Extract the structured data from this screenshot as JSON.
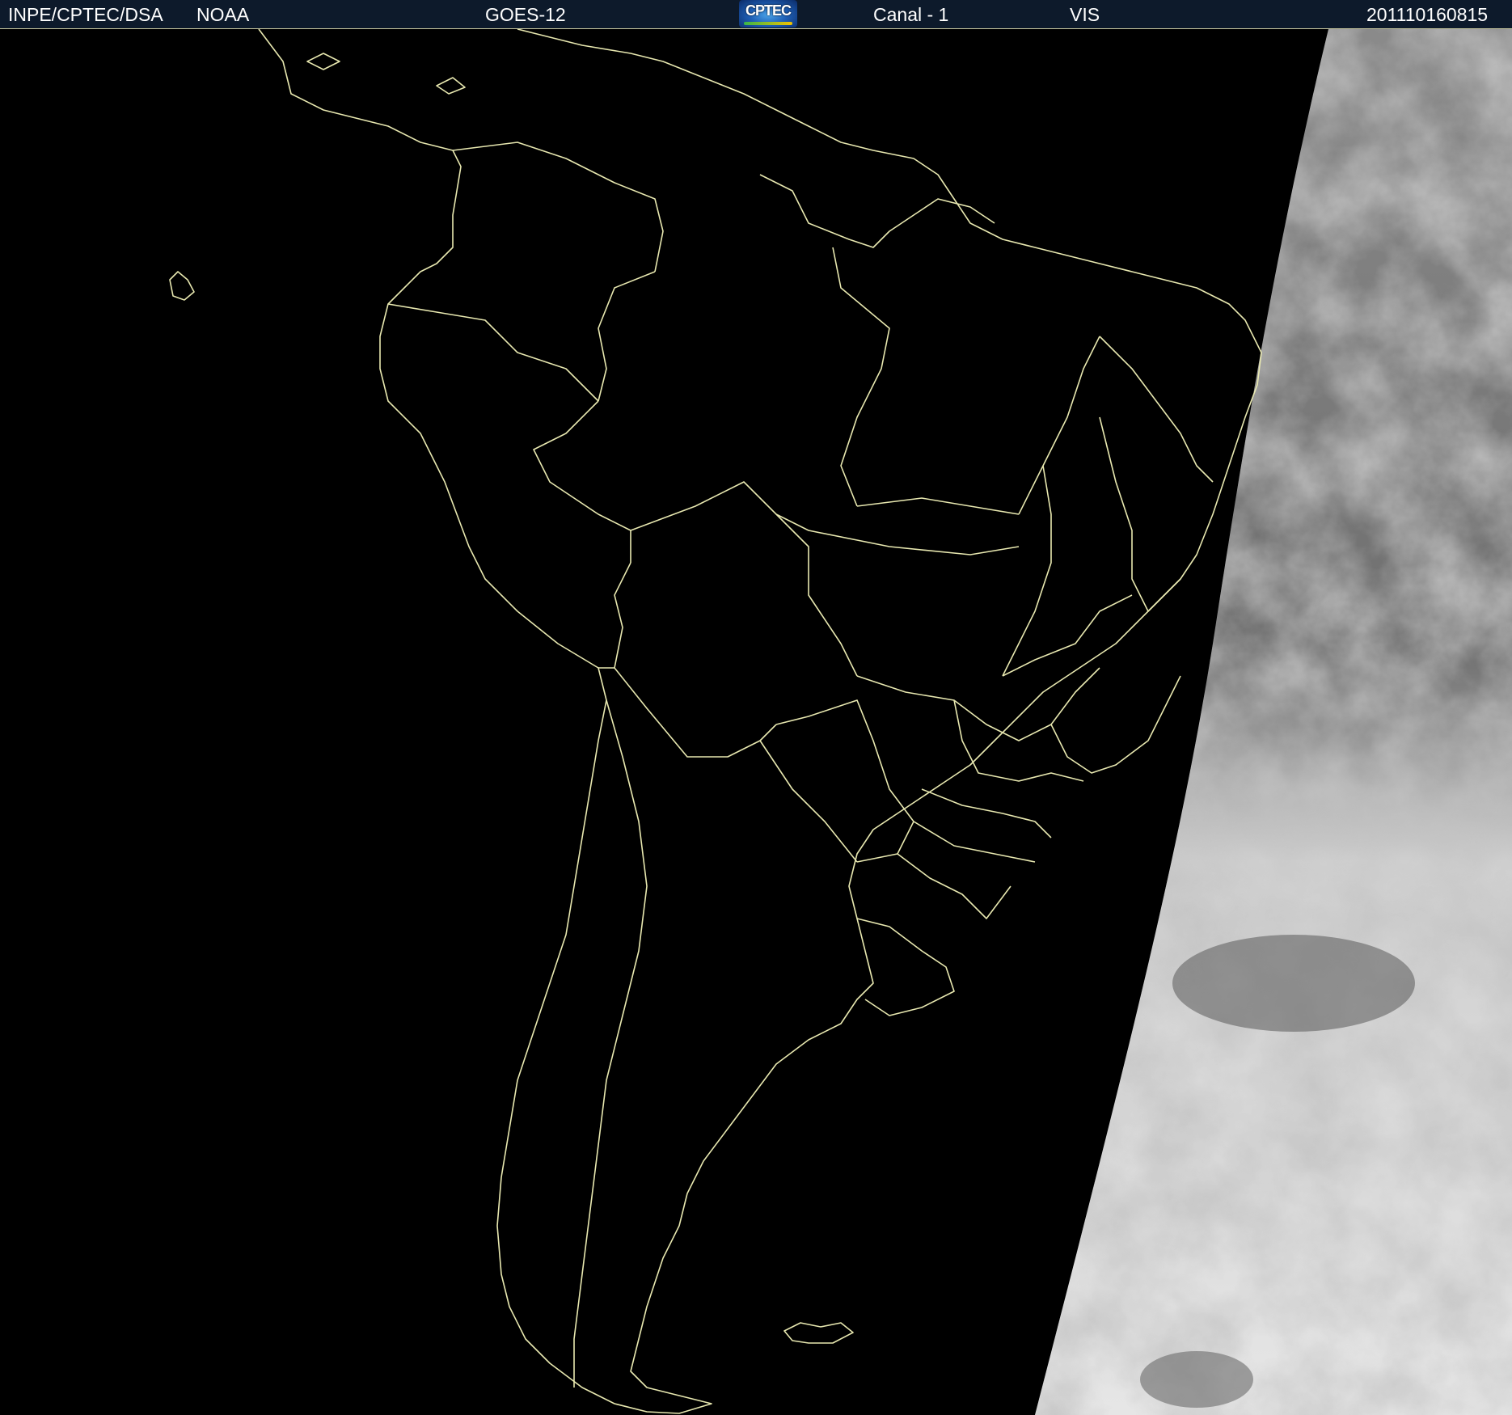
{
  "header": {
    "organization": "INPE/CPTEC/DSA",
    "agency": "NOAA",
    "satellite": "GOES-12",
    "logo_text": "CPTEC",
    "channel": "Canal - 1",
    "band": "VIS",
    "timestamp": "201110160815"
  },
  "map": {
    "region": "South America",
    "background_color": "#000000",
    "border_color": "#e8e8b0",
    "cloud_color": "#c8c8c8"
  }
}
